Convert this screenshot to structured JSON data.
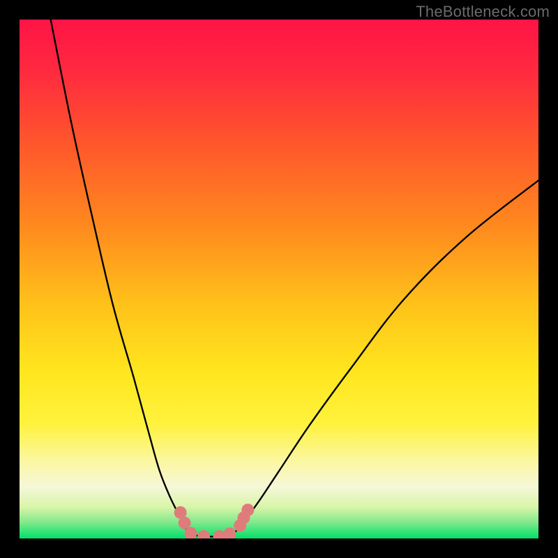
{
  "watermark": {
    "text": "TheBottleneck.com"
  },
  "colors": {
    "frame": "#000000",
    "curve_stroke": "#000000",
    "marker_fill": "#e07b7b",
    "gradient_stops": [
      {
        "offset": 0.0,
        "color": "#ff1446"
      },
      {
        "offset": 0.1,
        "color": "#ff2a3f"
      },
      {
        "offset": 0.25,
        "color": "#ff5a2a"
      },
      {
        "offset": 0.4,
        "color": "#ff8a1e"
      },
      {
        "offset": 0.55,
        "color": "#ffc21a"
      },
      {
        "offset": 0.68,
        "color": "#ffe61e"
      },
      {
        "offset": 0.78,
        "color": "#fff23e"
      },
      {
        "offset": 0.85,
        "color": "#fbf7a0"
      },
      {
        "offset": 0.9,
        "color": "#f6f7d8"
      },
      {
        "offset": 0.94,
        "color": "#d8f5a8"
      },
      {
        "offset": 0.97,
        "color": "#7de88a"
      },
      {
        "offset": 1.0,
        "color": "#00e06a"
      }
    ]
  },
  "chart_data": {
    "type": "line",
    "title": "",
    "xlabel": "",
    "ylabel": "",
    "xlim": [
      0,
      100
    ],
    "ylim": [
      0,
      100
    ],
    "series": [
      {
        "name": "left-curve",
        "x": [
          6,
          10,
          14,
          18,
          22,
          25,
          27,
          29,
          31,
          32,
          33
        ],
        "y": [
          100,
          80,
          62,
          45,
          31,
          20,
          13,
          8,
          4,
          2,
          0.8
        ]
      },
      {
        "name": "valley-flat",
        "x": [
          33,
          36,
          39,
          41
        ],
        "y": [
          0.8,
          0.4,
          0.4,
          0.8
        ]
      },
      {
        "name": "right-curve",
        "x": [
          41,
          43,
          46,
          50,
          56,
          64,
          74,
          86,
          100
        ],
        "y": [
          0.8,
          3,
          7,
          13,
          22,
          33,
          46,
          58,
          69
        ]
      }
    ],
    "markers": [
      {
        "x": 31.0,
        "y": 5.0
      },
      {
        "x": 31.8,
        "y": 3.0
      },
      {
        "x": 33.0,
        "y": 1.0
      },
      {
        "x": 35.5,
        "y": 0.4
      },
      {
        "x": 38.5,
        "y": 0.4
      },
      {
        "x": 40.5,
        "y": 0.9
      },
      {
        "x": 42.5,
        "y": 2.5
      },
      {
        "x": 43.2,
        "y": 4.0
      },
      {
        "x": 44.0,
        "y": 5.5
      }
    ],
    "marker_radius_px": 9
  }
}
